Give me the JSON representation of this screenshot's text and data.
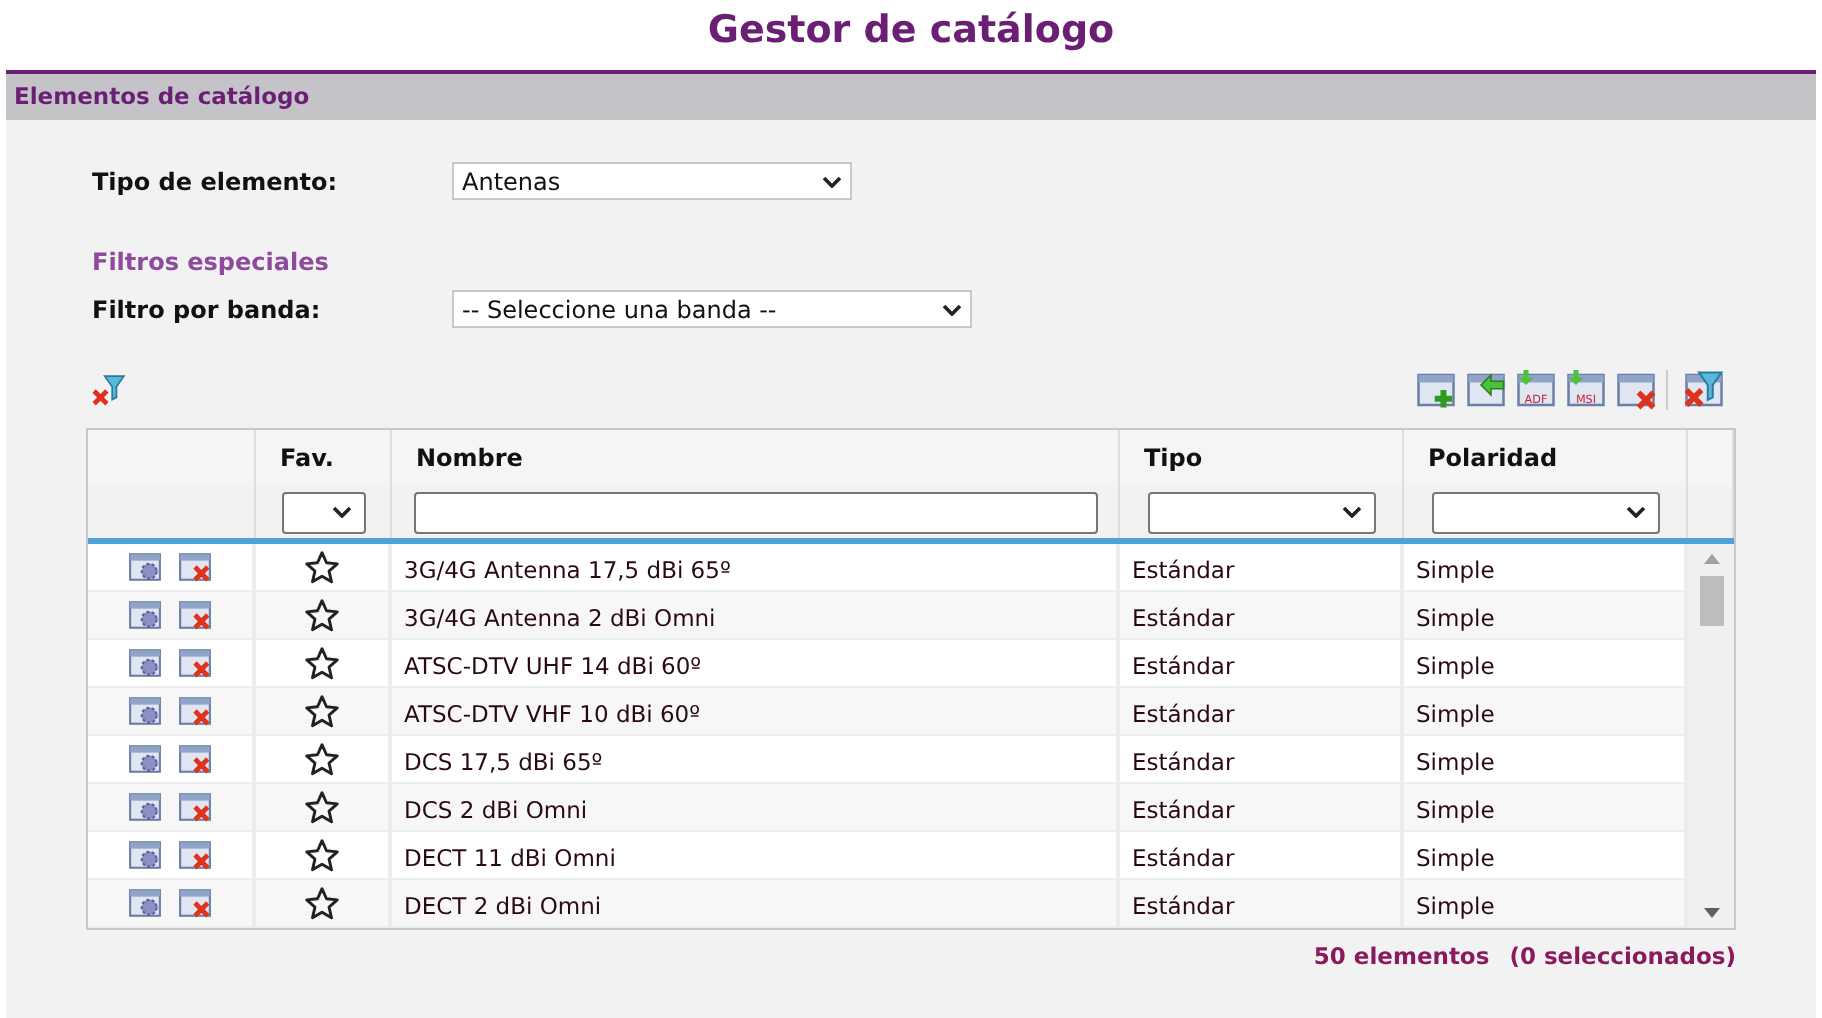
{
  "title": "Gestor de catálogo",
  "section": {
    "title": "Elementos de catálogo"
  },
  "tipo": {
    "label": "Tipo de elemento:",
    "value": "Antenas"
  },
  "filters_heading": "Filtros especiales",
  "banda": {
    "label": "Filtro por banda:",
    "value": "-- Seleccione una banda --"
  },
  "table": {
    "columns": [
      "Fav.",
      "Nombre",
      "Tipo",
      "Polaridad"
    ],
    "rows": [
      {
        "favorite": false,
        "name": "3G/4G Antenna 17,5 dBi 65º",
        "tipo": "Estándar",
        "polaridad": "Simple"
      },
      {
        "favorite": false,
        "name": "3G/4G Antenna 2 dBi Omni",
        "tipo": "Estándar",
        "polaridad": "Simple"
      },
      {
        "favorite": false,
        "name": "ATSC-DTV UHF 14 dBi 60º",
        "tipo": "Estándar",
        "polaridad": "Simple"
      },
      {
        "favorite": false,
        "name": "ATSC-DTV VHF 10 dBi 60º",
        "tipo": "Estándar",
        "polaridad": "Simple"
      },
      {
        "favorite": false,
        "name": "DCS 17,5 dBi 65º",
        "tipo": "Estándar",
        "polaridad": "Simple"
      },
      {
        "favorite": false,
        "name": "DCS 2 dBi Omni",
        "tipo": "Estándar",
        "polaridad": "Simple"
      },
      {
        "favorite": false,
        "name": "DECT 11 dBi Omni",
        "tipo": "Estándar",
        "polaridad": "Simple"
      },
      {
        "favorite": false,
        "name": "DECT 2 dBi Omni",
        "tipo": "Estándar",
        "polaridad": "Simple"
      }
    ]
  },
  "footer": {
    "count": "50 elementos",
    "selected": "(0 seleccionados)"
  },
  "toolbar": [
    {
      "kind": "add"
    },
    {
      "kind": "import"
    },
    {
      "kind": "export",
      "badge": "ADF"
    },
    {
      "kind": "export",
      "badge": "MSI"
    },
    {
      "kind": "delete"
    },
    {
      "kind": "clear-filter"
    }
  ]
}
